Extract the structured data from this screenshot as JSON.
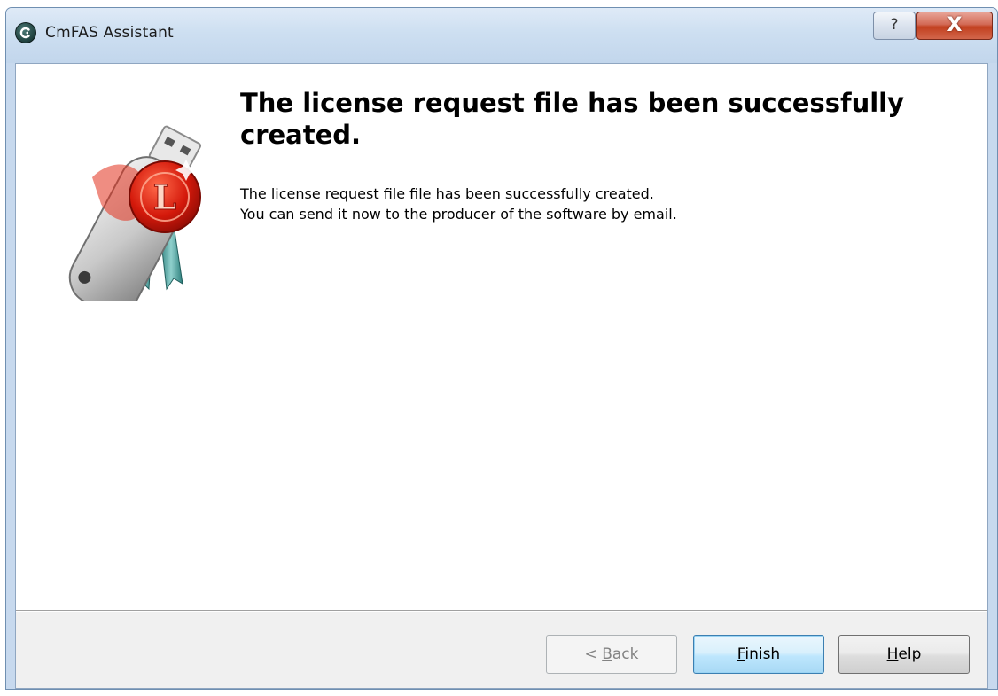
{
  "window": {
    "title": "CmFAS Assistant",
    "app_icon": "cmfas-logo-icon",
    "help_button_glyph": "?",
    "close_button_glyph": "X"
  },
  "content": {
    "heading": "The license request file has been successfully created.",
    "line1": "The license request file file has been successfully created.",
    "line2": "You can send it now to the producer of the software by email.",
    "hero_image": "usb-license-dongle-with-wax-seal",
    "seal_letter": "L"
  },
  "footer": {
    "back": {
      "prefix": "< ",
      "mnemonic": "B",
      "rest": "ack",
      "state": "disabled"
    },
    "finish": {
      "mnemonic": "F",
      "rest": "inish",
      "state": "default"
    },
    "help": {
      "mnemonic": "H",
      "rest": "elp",
      "state": "normal"
    }
  },
  "colors": {
    "titlebar": "#c7d9ee",
    "close_button": "#c2401f",
    "default_button": "#bee6fd",
    "footer_bg": "#f0f0f0"
  }
}
